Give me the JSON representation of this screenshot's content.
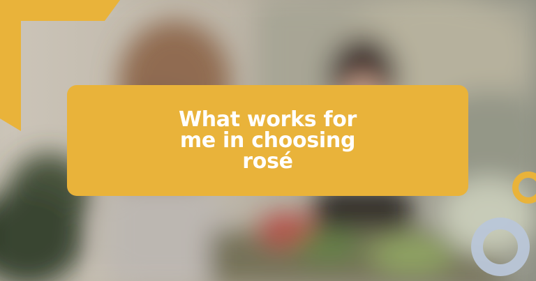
{
  "hero": {
    "title": "What works for me in choosing rosé",
    "accent_color": "#e9b33a",
    "secondary_color": "#b9c6d8",
    "text_color": "#ffffff"
  }
}
